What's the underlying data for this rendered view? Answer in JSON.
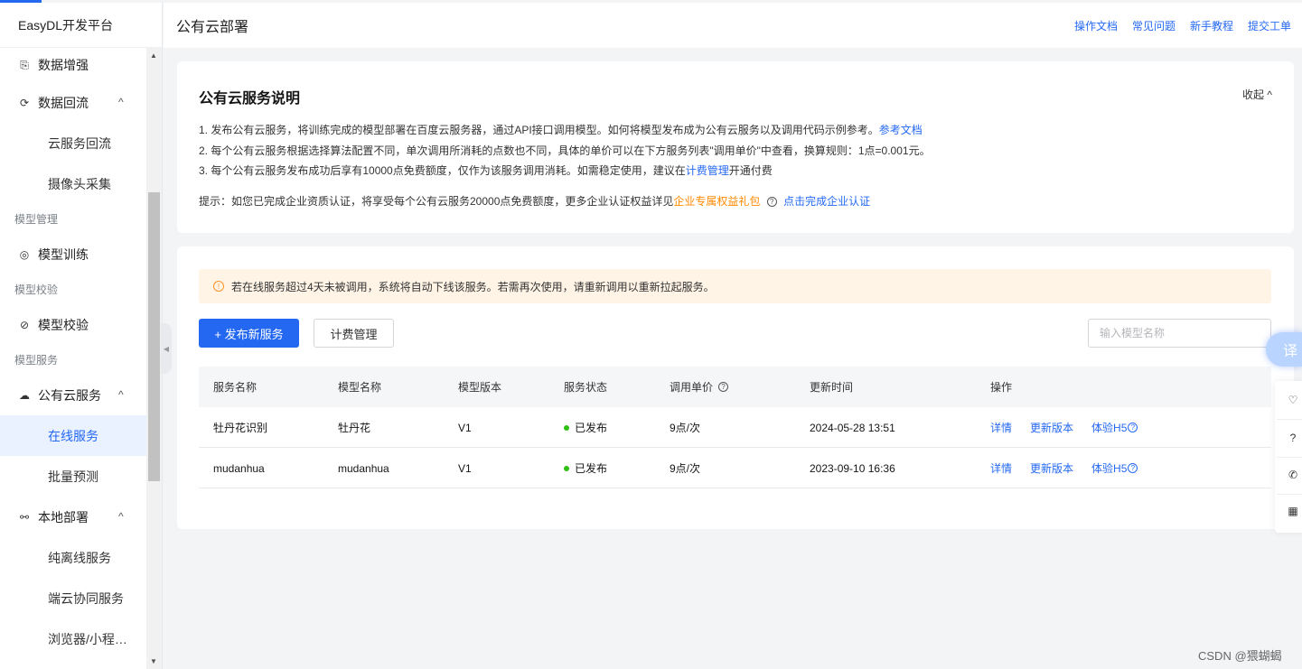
{
  "app": {
    "name": "EasyDL开发平台"
  },
  "sidebar": {
    "items": [
      {
        "label": "数据增强",
        "icon": "data-augment-icon"
      },
      {
        "label": "数据回流",
        "icon": "data-backflow-icon",
        "chevron": "^"
      },
      {
        "label": "云服务回流"
      },
      {
        "label": "摄像头采集"
      },
      {
        "label": "模型管理"
      },
      {
        "label": "模型训练",
        "icon": "model-train-icon"
      },
      {
        "label": "模型校验"
      },
      {
        "label": "模型校验",
        "icon": "check-circle-icon"
      },
      {
        "label": "模型服务"
      },
      {
        "label": "公有云服务",
        "icon": "cloud-icon",
        "chevron": "^"
      },
      {
        "label": "在线服务",
        "active": true
      },
      {
        "label": "批量预测"
      },
      {
        "label": "本地部署",
        "icon": "deploy-icon",
        "chevron": "^"
      },
      {
        "label": "纯离线服务"
      },
      {
        "label": "端云协同服务"
      },
      {
        "label": "浏览器/小程…"
      }
    ]
  },
  "header": {
    "title": "公有云部署",
    "links": [
      "操作文档",
      "常见问题",
      "新手教程",
      "提交工单"
    ]
  },
  "info": {
    "title": "公有云服务说明",
    "collapse_label": "收起",
    "line1_text": "1. 发布公有云服务，将训练完成的模型部署在百度云服务器，通过API接口调用模型。如何将模型发布成为公有云服务以及调用代码示例参考。",
    "line1_link": "参考文档",
    "line2_text": "2. 每个公有云服务根据选择算法配置不同，单次调用所消耗的点数也不同，具体的单价可以在下方服务列表\"调用单价\"中查看，换算规则：1点=0.001元。",
    "line3_pre": "3. 每个公有云服务发布成功后享有10000点免费额度，仅作为该服务调用消耗。如需稳定使用，建议在",
    "line3_link": "计费管理",
    "line3_post": "开通付费",
    "tip_pre": "提示：如您已完成企业资质认证，将享受每个公有云服务20000点免费额度，更多企业认证权益详见",
    "tip_orange": "企业专属权益礼包",
    "tip_link": "点击完成企业认证"
  },
  "service": {
    "alert": "若在线服务超过4天未被调用，系统将自动下线该服务。若需再次使用，请重新调用以重新拉起服务。",
    "publish_button": "+ 发布新服务",
    "billing_button": "计费管理",
    "search_placeholder": "输入模型名称",
    "columns": [
      "服务名称",
      "模型名称",
      "模型版本",
      "服务状态",
      "调用单价",
      "更新时间",
      "操作"
    ],
    "rows": [
      {
        "service": "牡丹花识别",
        "model": "牡丹花",
        "version": "V1",
        "status": "已发布",
        "price": "9点/次",
        "updated": "2024-05-28 13:51",
        "ops": [
          "详情",
          "更新版本",
          "体验H5"
        ]
      },
      {
        "service": "mudanhua",
        "model": "mudanhua",
        "version": "V1",
        "status": "已发布",
        "price": "9点/次",
        "updated": "2023-09-10 16:36",
        "ops": [
          "详情",
          "更新版本",
          "体验H5"
        ]
      }
    ],
    "status_color": "#30bf13"
  },
  "floating": {
    "translate_label": "译"
  },
  "watermark": "CSDN @猥蝴蝎",
  "colors": {
    "accent": "#2468f2",
    "active_bg": "#eaf1ff",
    "alert_bg": "#fff4e6",
    "warning": "#ff9326"
  }
}
